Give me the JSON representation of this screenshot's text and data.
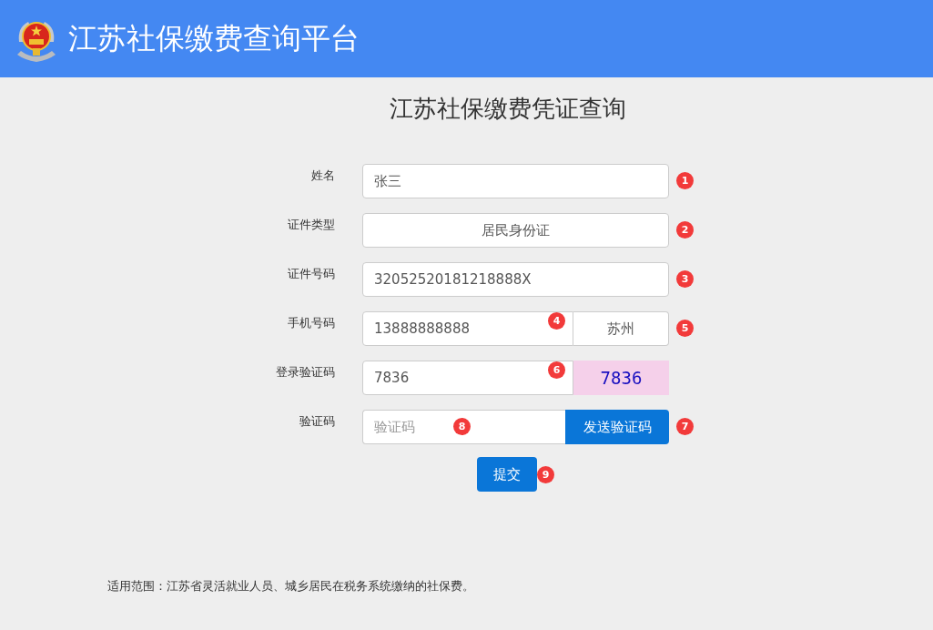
{
  "header": {
    "title": "江苏社保缴费查询平台"
  },
  "page_title": "江苏社保缴费凭证查询",
  "rows": [
    {
      "label": "姓名",
      "kind": "text",
      "value": "张三",
      "badge": "1"
    },
    {
      "label": "证件类型",
      "kind": "select",
      "value": "居民身份证",
      "badge": "2"
    },
    {
      "label": "证件号码",
      "kind": "text",
      "value": "32052520181218888X",
      "badge": "3"
    },
    {
      "label": "手机号码",
      "kind": "split",
      "value": "13888888888",
      "badge": "4",
      "addon": {
        "value": "苏州",
        "badge": "5"
      }
    },
    {
      "label": "登录验证码",
      "kind": "captcha",
      "value": "7836",
      "badge": "6",
      "captcha": "7836"
    },
    {
      "label": "验证码",
      "kind": "code",
      "placeholder": "验证码",
      "badge": "8",
      "button": {
        "label": "发送验证码",
        "badge": "7"
      }
    }
  ],
  "submit": {
    "label": "提交",
    "badge": "9"
  },
  "footnote": "适用范围：江苏省灵活就业人员、城乡居民在税务系统缴纳的社保费。"
}
